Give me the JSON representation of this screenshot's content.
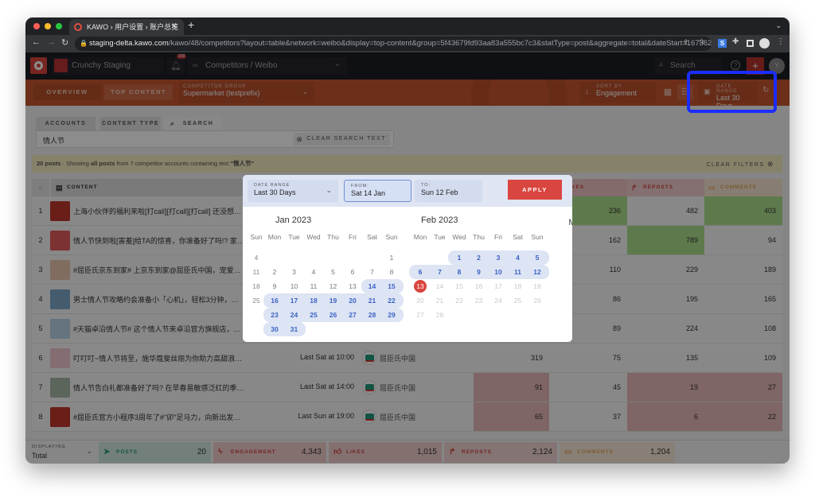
{
  "browser": {
    "tab_title": "KAWO › 用户设置 › 账户总览",
    "url_host": "staging-delta.kawo.com",
    "url_path": "/kawo/48/competitors?layout=table&network=weibo&display=top-content&group=5f43679fd93aa83a555bc7c3&statType=post&aggregate=total&dateStart=167362560..."
  },
  "appbar": {
    "workspace": "Crunchy Staging",
    "notif_count": "100",
    "section": "Competitors / Weibo",
    "search_placeholder": "Search",
    "avatar_letter": "Y"
  },
  "subnav": {
    "overview": "OVERVIEW",
    "top_content": "TOP CONTENT",
    "group_label": "COMPETITOR GROUP",
    "group_value": "Supermarket (testprefix)",
    "sort_label": "SORT BY",
    "sort_value": "Engagement",
    "date_label": "DATE RANGE",
    "date_value": "Last 30 Days"
  },
  "filters": {
    "tabs": [
      "ACCOUNTS",
      "CONTENT TYPE",
      "SEARCH"
    ],
    "search_value": "情人节",
    "clear_search": "CLEAR SEARCH TEXT",
    "summary_count": "20 posts",
    "summary_pre": " · Showing ",
    "summary_bold": "all posts",
    "summary_post": " from 7 competitor accounts containing text ",
    "summary_query": "\"情人节\"",
    "clear_filters": "CLEAR FILTERS"
  },
  "table": {
    "headers": {
      "content": "CONTENT",
      "likes": "LIKES",
      "reposts": "REPOSTS",
      "comments": "COMMENTS"
    },
    "rows": [
      {
        "rank": "1",
        "text": "上海小伙伴的福利来啦[打call][打call][打call] 还没想好...",
        "date": null,
        "account": null,
        "engagement": null,
        "likes": "236",
        "reposts": "482",
        "comments": "403",
        "thumb": "#c0392b",
        "hi": {
          "likes": "green",
          "comments": "green"
        }
      },
      {
        "rank": "2",
        "text": "情人节快到啦[害羞]给TA的惊喜，你准备好了吗!? 家乐...",
        "date": null,
        "account": null,
        "engagement": null,
        "likes": "162",
        "reposts": "789",
        "comments": "94",
        "thumb": "#e25b5b",
        "hi": {
          "reposts": "green"
        }
      },
      {
        "rank": "3",
        "text": "#屈臣氏京东到家# 上京东到家@屈臣氏中国，宠爱有礼...",
        "date": null,
        "account": null,
        "engagement": null,
        "likes": "110",
        "reposts": "229",
        "comments": "189",
        "thumb": "#e9c7b0",
        "hi": {}
      },
      {
        "rank": "4",
        "text": "男士情人节攻略约会准备小「心机」，轻松3分钟，打造...",
        "date": null,
        "account": null,
        "engagement": null,
        "likes": "86",
        "reposts": "195",
        "comments": "165",
        "thumb": "#7fa8c9",
        "hi": {}
      },
      {
        "rank": "5",
        "text": "#天猫卓沿情人节# 这个情人节来卓沿官方旗舰店，守护...",
        "date": null,
        "account": "屈臣氏中国",
        "engagement": null,
        "likes": "89",
        "reposts": "224",
        "comments": "108",
        "thumb": "#b9d3e8",
        "hi": {}
      },
      {
        "rank": "6",
        "text": "叮叮叮~情人节将至，施华蔻斐丝丽为你助力高甜浪漫约...",
        "date": "Last Sat at 10:00",
        "account": "屈臣氏中国",
        "engagement": "319",
        "likes": "75",
        "reposts": "135",
        "comments": "109",
        "thumb": "#f0c8d0",
        "hi": {}
      },
      {
        "rank": "7",
        "text": "情人节告白礼都准备好了吗? 在早春易敏感泛红的季节...",
        "date": "Last Sat at 14:00",
        "account": "屈臣氏中国",
        "engagement": "91",
        "likes": "45",
        "reposts": "19",
        "comments": "27",
        "thumb": "#a8b8a8",
        "hi": {
          "engagement": "red",
          "reposts": "red",
          "comments": "red"
        }
      },
      {
        "rank": "8",
        "text": "#屈臣氏官方小程序3周年了#\"卯\"足马力，向新出发，屈...",
        "date": "Last Sun at 19:00",
        "account": "屈臣氏中国",
        "engagement": "65",
        "likes": "37",
        "reposts": "6",
        "comments": "22",
        "thumb": "#c0392b",
        "hi": {
          "engagement": "red",
          "reposts": "red",
          "comments": "red"
        }
      }
    ]
  },
  "footer": {
    "displaying_label": "DISPLAYING",
    "displaying_value": "Total",
    "posts_label": "POSTS",
    "posts": "20",
    "engagement_label": "ENGAGEMENT",
    "engagement": "4,343",
    "likes_label": "LIKES",
    "likes": "1,015",
    "reposts_label": "REPOSTS",
    "reposts": "2,124",
    "comments_label": "COMMENTS",
    "comments": "1,204"
  },
  "datepicker": {
    "range_label": "DATE RANGE",
    "range_value": "Last 30 Days",
    "from_label": "FROM:",
    "from_value": "Sat 14 Jan",
    "to_label": "TO:",
    "to_value": "Sun 12 Feb",
    "apply": "APPLY",
    "weekdays": [
      "Mon",
      "Tue",
      "Wed",
      "Thu",
      "Fri",
      "Sat",
      "Sun"
    ],
    "prev_partial": {
      "header": "Sun",
      "days": [
        "4",
        "11",
        "18",
        "25"
      ]
    },
    "next_partial": {
      "header": "M"
    },
    "months": [
      {
        "title": "Jan 2023",
        "weeks": [
          [
            null,
            null,
            null,
            null,
            null,
            null,
            1
          ],
          [
            2,
            3,
            4,
            5,
            6,
            7,
            8
          ],
          [
            9,
            10,
            11,
            12,
            13,
            14,
            15
          ],
          [
            16,
            17,
            18,
            19,
            20,
            21,
            22
          ],
          [
            23,
            24,
            25,
            26,
            27,
            28,
            29
          ],
          [
            30,
            31
          ]
        ],
        "selected_from": 14,
        "selected_to": 31
      },
      {
        "title": "Feb 2023",
        "weeks": [
          [
            null,
            null,
            1,
            2,
            3,
            4,
            5
          ],
          [
            6,
            7,
            8,
            9,
            10,
            11,
            12
          ],
          [
            13,
            14,
            15,
            16,
            17,
            18,
            19
          ],
          [
            20,
            21,
            22,
            23,
            24,
            25,
            26
          ],
          [
            27,
            28
          ]
        ],
        "selected_from": 1,
        "selected_to": 12,
        "today": 13
      }
    ]
  },
  "colors": {
    "brand_orange": "#c6572f",
    "apply_red": "#d9453f",
    "selected_blue": "#3b63c4",
    "highlight_blue": "#1b2cff",
    "good_green": "#abde8a",
    "bad_red": "#e7b8b8"
  }
}
